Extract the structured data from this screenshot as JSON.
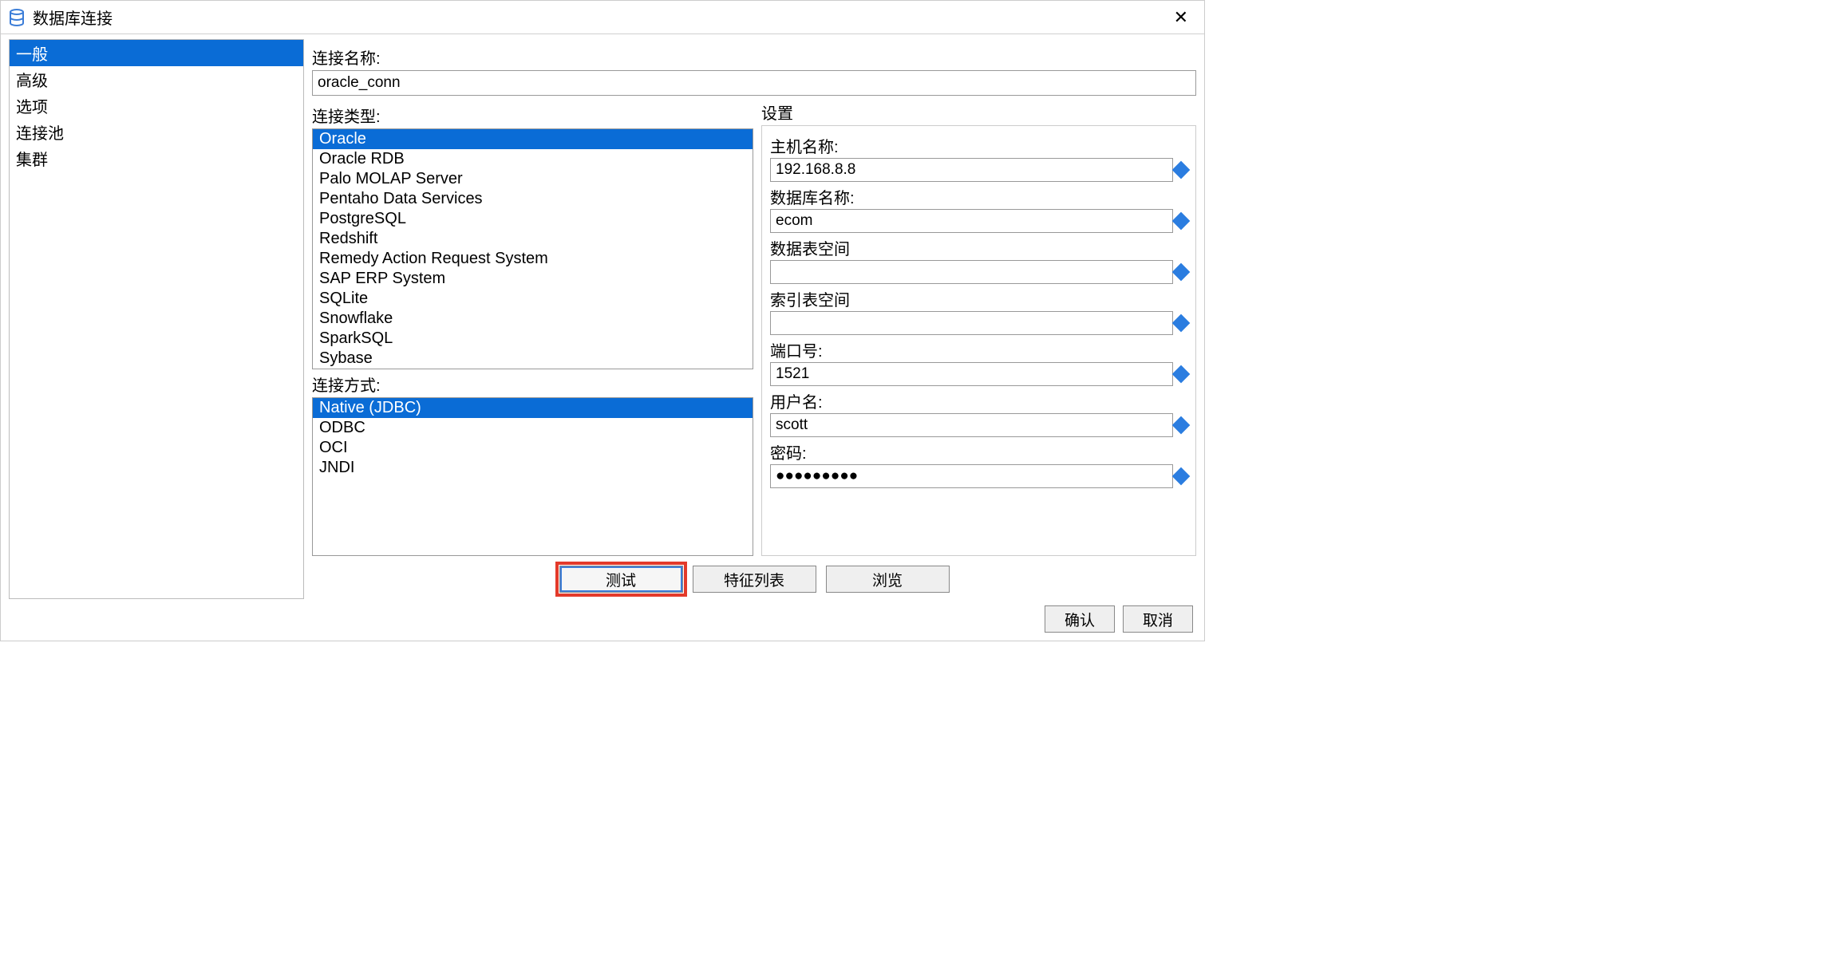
{
  "window": {
    "title": "数据库连接"
  },
  "sidebar": {
    "items": [
      {
        "label": "一般",
        "selected": true
      },
      {
        "label": "高级",
        "selected": false
      },
      {
        "label": "选项",
        "selected": false
      },
      {
        "label": "连接池",
        "selected": false
      },
      {
        "label": "集群",
        "selected": false
      }
    ]
  },
  "connection": {
    "name_label": "连接名称:",
    "name_value": "oracle_conn",
    "type_label": "连接类型:",
    "types": [
      {
        "label": "Oracle",
        "selected": true
      },
      {
        "label": "Oracle RDB",
        "selected": false
      },
      {
        "label": "Palo MOLAP Server",
        "selected": false
      },
      {
        "label": "Pentaho Data Services",
        "selected": false
      },
      {
        "label": "PostgreSQL",
        "selected": false
      },
      {
        "label": "Redshift",
        "selected": false
      },
      {
        "label": "Remedy Action Request System",
        "selected": false
      },
      {
        "label": "SAP ERP System",
        "selected": false
      },
      {
        "label": "SQLite",
        "selected": false
      },
      {
        "label": "Snowflake",
        "selected": false
      },
      {
        "label": "SparkSQL",
        "selected": false
      },
      {
        "label": "Sybase",
        "selected": false
      }
    ],
    "method_label": "连接方式:",
    "methods": [
      {
        "label": "Native (JDBC)",
        "selected": true
      },
      {
        "label": "ODBC",
        "selected": false
      },
      {
        "label": "OCI",
        "selected": false
      },
      {
        "label": "JNDI",
        "selected": false
      }
    ]
  },
  "settings": {
    "legend": "设置",
    "host_label": "主机名称:",
    "host_value": "192.168.8.8",
    "dbname_label": "数据库名称:",
    "dbname_value": "ecom",
    "tablespace_label": "数据表空间",
    "tablespace_value": "",
    "indexspace_label": "索引表空间",
    "indexspace_value": "",
    "port_label": "端口号:",
    "port_value": "1521",
    "user_label": "用户名:",
    "user_value": "scott",
    "password_label": "密码:",
    "password_value": "●●●●●●●●●"
  },
  "buttons": {
    "test": "测试",
    "feature_list": "特征列表",
    "browse": "浏览",
    "ok": "确认",
    "cancel": "取消"
  }
}
